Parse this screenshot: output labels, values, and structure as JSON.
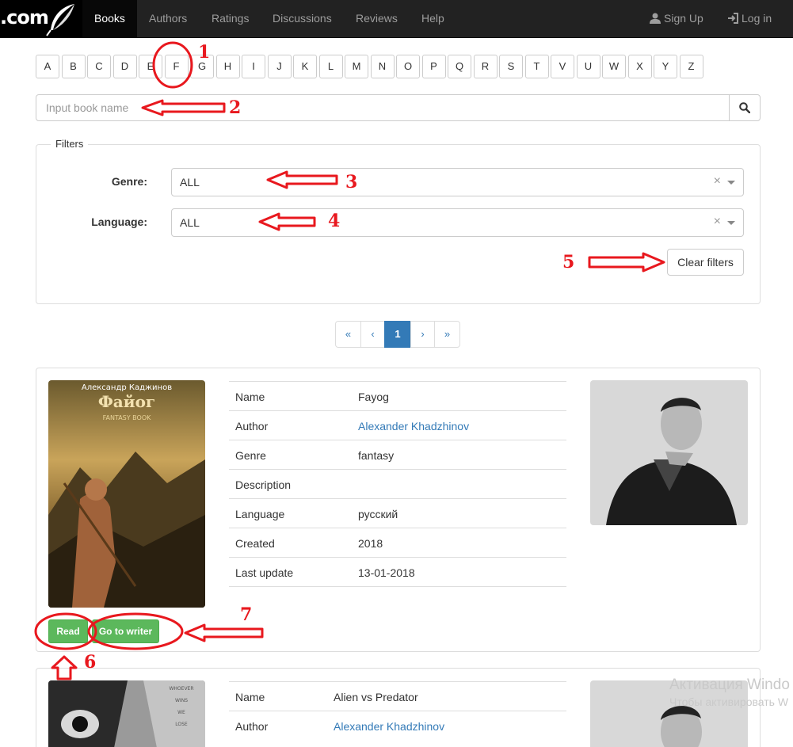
{
  "nav": {
    "brand": ".com",
    "items": [
      {
        "label": "Books",
        "active": true
      },
      {
        "label": "Authors",
        "active": false
      },
      {
        "label": "Ratings",
        "active": false
      },
      {
        "label": "Discussions",
        "active": false
      },
      {
        "label": "Reviews",
        "active": false
      },
      {
        "label": "Help",
        "active": false
      }
    ],
    "signup": "Sign Up",
    "login": "Log in"
  },
  "letters": [
    "A",
    "B",
    "C",
    "D",
    "E",
    "F",
    "G",
    "H",
    "I",
    "J",
    "K",
    "L",
    "M",
    "N",
    "O",
    "P",
    "Q",
    "R",
    "S",
    "T",
    "V",
    "U",
    "W",
    "X",
    "Y",
    "Z"
  ],
  "search": {
    "placeholder": "Input book name",
    "icon": "search-icon"
  },
  "filters": {
    "legend": "Filters",
    "genre_label": "Genre:",
    "genre_value": "ALL",
    "language_label": "Language:",
    "language_value": "ALL",
    "clear_label": "Clear filters"
  },
  "pagination": {
    "first": "«",
    "prev": "‹",
    "current": "1",
    "next": "›",
    "last": "»"
  },
  "books": [
    {
      "cover_author": "Александр Каджинов",
      "cover_title": "Файог",
      "cover_subtitle": "FANTASY BOOK",
      "fields": [
        {
          "key": "Name",
          "value": "Fayog"
        },
        {
          "key": "Author",
          "value": "Alexander Khadzhinov",
          "link": true
        },
        {
          "key": "Genre",
          "value": "fantasy"
        },
        {
          "key": "Description",
          "value": ""
        },
        {
          "key": "Language",
          "value": "русский"
        },
        {
          "key": "Created",
          "value": "2018"
        },
        {
          "key": "Last update",
          "value": "13-01-2018"
        }
      ],
      "read_label": "Read",
      "writer_label": "Go to writer"
    },
    {
      "cover_text": [
        "WHOEVER",
        "WINS",
        "WE",
        "LOSE"
      ],
      "fields": [
        {
          "key": "Name",
          "value": "Alien vs Predator"
        },
        {
          "key": "Author",
          "value": "Alexander Khadzhinov",
          "link": true
        }
      ]
    }
  ],
  "annotations": [
    "1",
    "2",
    "3",
    "4",
    "5",
    "6",
    "7"
  ],
  "watermark": {
    "line1": "Активация Windo",
    "line2": "Чтобы активировать W"
  },
  "colors": {
    "navbar": "#222222",
    "primary": "#337ab7",
    "success": "#5cb85c",
    "annotation": "#e8181e"
  }
}
